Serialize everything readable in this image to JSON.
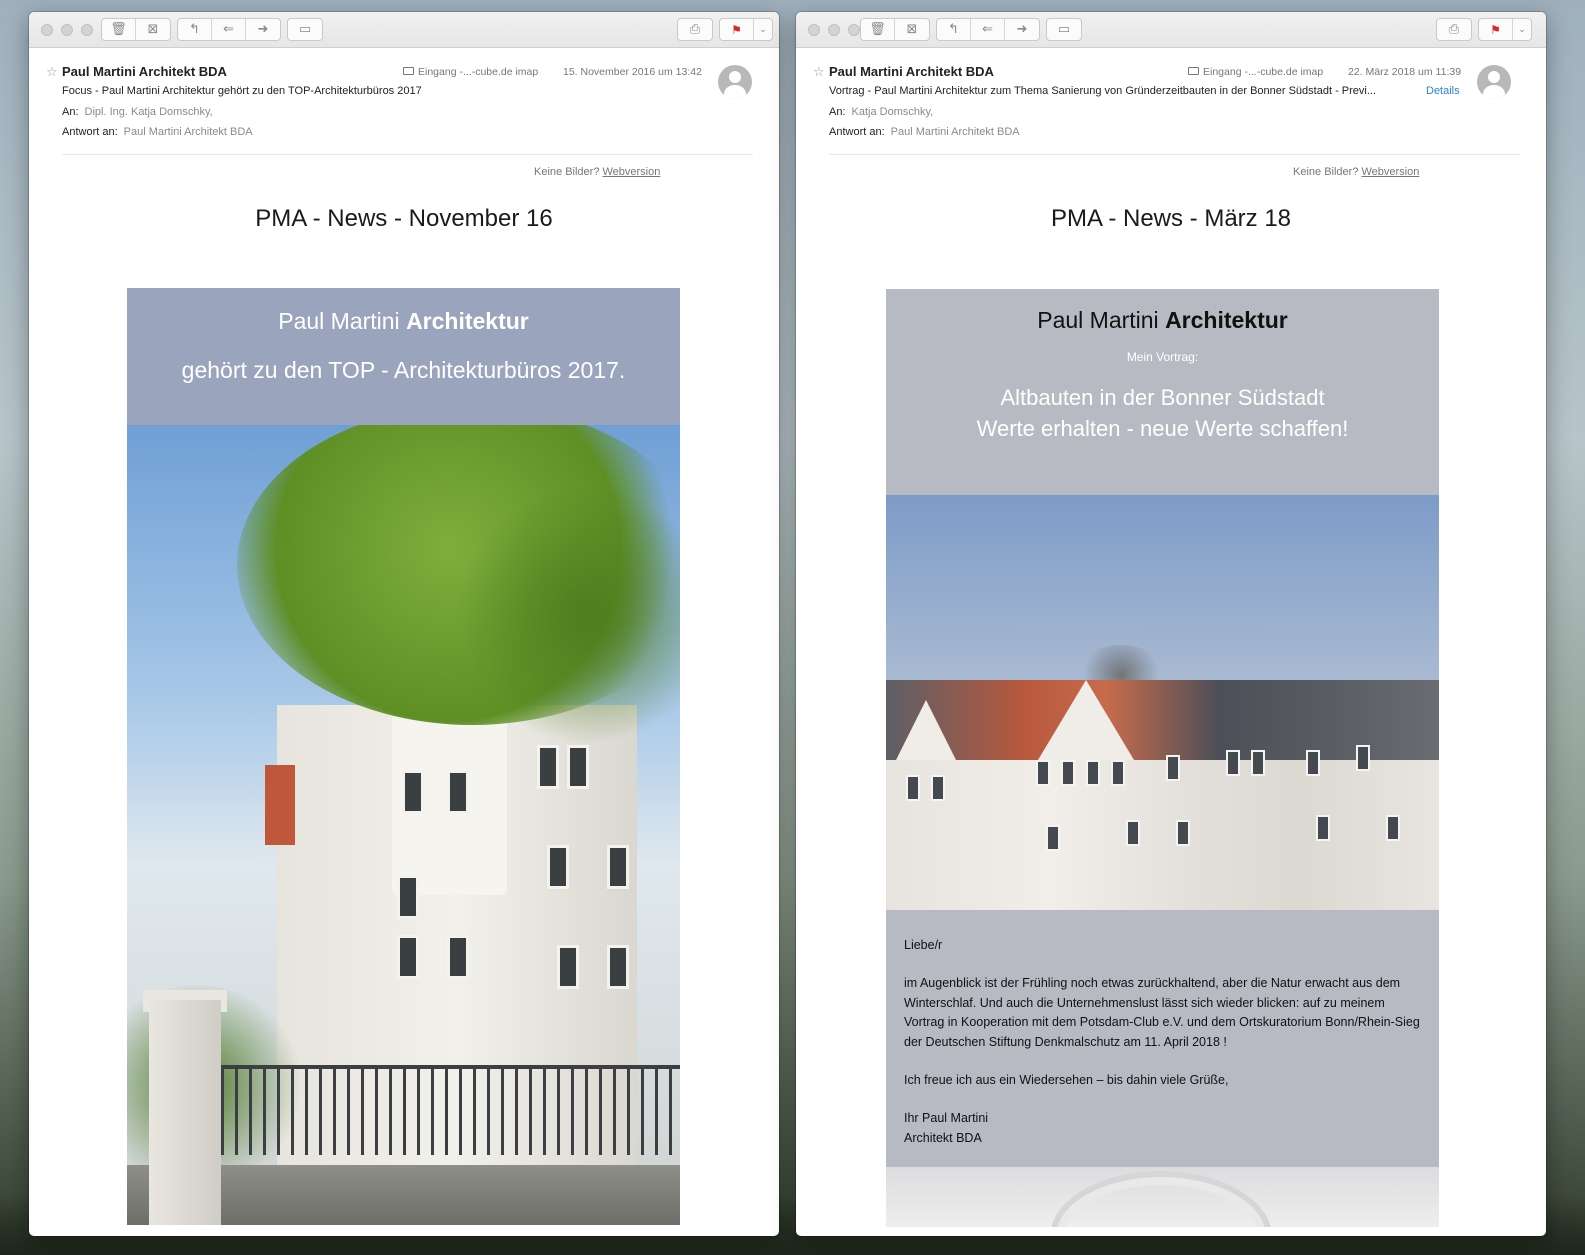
{
  "left": {
    "sender": "Paul Martini Architekt BDA",
    "mailbox": "Eingang -...-cube.de imap",
    "date": "15. November 2016 um 13:42",
    "subject": "Focus - Paul Martini Architektur gehört zu den TOP-Architekturbüros 2017",
    "to_label": "An:",
    "to_value": "Dipl. Ing. Katja Domschky,",
    "reply_label": "Antwort an:",
    "reply_value": "Paul Martini Architekt BDA",
    "no_images": "Keine Bilder?",
    "webversion": "Webversion",
    "news_title": "PMA - News - November 16",
    "brand_light": "Paul Martini",
    "brand_bold": "Architektur",
    "tagline": "gehört zu den TOP - Architekturbüros 2017."
  },
  "right": {
    "sender": "Paul Martini Architekt BDA",
    "mailbox": "Eingang -...-cube.de imap",
    "date": "22. März 2018 um 11:39",
    "subject": "Vortrag - Paul Martini Architektur zum Thema Sanierung von Gründerzeitbauten in der Bonner Südstadt - Previ...",
    "details": "Details",
    "to_label": "An:",
    "to_value": "Katja Domschky,",
    "reply_label": "Antwort an:",
    "reply_value": "Paul Martini Architekt BDA",
    "no_images": "Keine Bilder?",
    "webversion": "Webversion",
    "news_title": "PMA - News - März 18",
    "brand_light": "Paul Martini",
    "brand_bold": "Architektur",
    "subheading": "Mein Vortrag:",
    "headline_1": "Altbauten in der Bonner Südstadt",
    "headline_2": "Werte erhalten - neue Werte schaffen!",
    "greeting": "Liebe/r",
    "paragraph": "im Augenblick ist der Frühling noch etwas zurückhaltend, aber die Natur erwacht aus dem Winterschlaf. Und auch die Unternehmenslust lässt sich wieder blicken: auf zu meinem Vortrag in Kooperation mit dem Potsdam-Club e.V. und dem Ortskuratorium Bonn/Rhein-Sieg der Deutschen Stiftung Denkmalschutz am 11. April 2018 !",
    "closing": "Ich freue ich aus ein Wiedersehen – bis dahin viele Grüße,",
    "sign_1": "Ihr Paul Martini",
    "sign_2": "Architekt BDA"
  },
  "toolbar": {
    "icons": [
      "trash-icon",
      "junk-icon",
      "reply-icon",
      "reply-all-icon",
      "forward-icon",
      "archive-icon",
      "print-icon",
      "flag-icon",
      "chevron-down-icon"
    ],
    "glyphs": {
      "trash": "🗑",
      "junk": "⊠",
      "reply": "↰",
      "reply_all": "⇐",
      "forward": "➜",
      "archive": "▭",
      "print": "⎙",
      "flag": "⚑",
      "chevron": "⌄",
      "star": "☆"
    },
    "flag_color": "#e02424"
  },
  "colors": {
    "left_banner": "#9aa4bd",
    "right_banner": "#b8bac3",
    "link": "#2a84d2"
  }
}
